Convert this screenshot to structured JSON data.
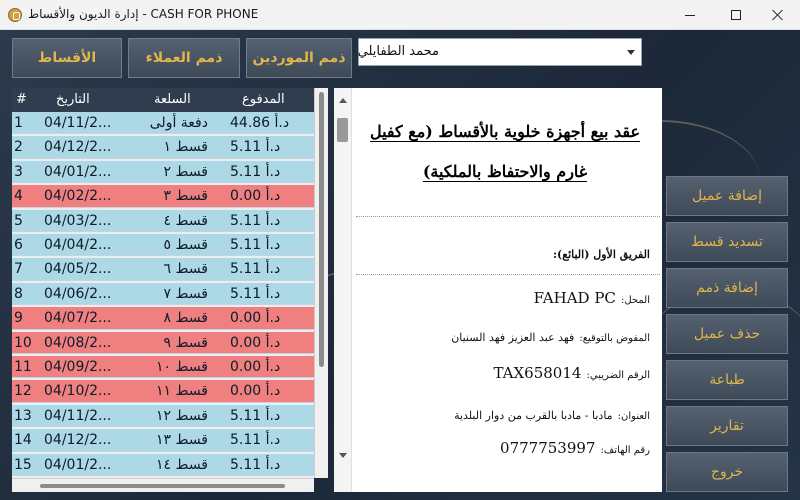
{
  "window": {
    "title": "إدارة الديون والأقساط - CASH FOR PHONE"
  },
  "nav": {
    "installments": "الأقساط",
    "customers_debts": "ذمم العملاء",
    "suppliers_debts": "ذمم الموردين"
  },
  "customer_select": {
    "value": "محمد الطفايلي"
  },
  "table": {
    "headers": {
      "num": "#",
      "date": "التاريخ",
      "item": "السلعة",
      "paid": "المدفوع"
    },
    "rows": [
      {
        "num": "1",
        "date": "04/11/2...",
        "item": "دفعة أولى",
        "paid": "د.أ 44.86",
        "status": "blue"
      },
      {
        "num": "2",
        "date": "04/12/2...",
        "item": "قسط ١",
        "paid": "د.أ 5.11",
        "status": "blue"
      },
      {
        "num": "3",
        "date": "04/01/2...",
        "item": "قسط ٢",
        "paid": "د.أ 5.11",
        "status": "blue"
      },
      {
        "num": "4",
        "date": "04/02/2...",
        "item": "قسط ٣",
        "paid": "د.أ 0.00",
        "status": "red"
      },
      {
        "num": "5",
        "date": "04/03/2...",
        "item": "قسط ٤",
        "paid": "د.أ 5.11",
        "status": "blue"
      },
      {
        "num": "6",
        "date": "04/04/2...",
        "item": "قسط ٥",
        "paid": "د.أ 5.11",
        "status": "blue"
      },
      {
        "num": "7",
        "date": "04/05/2...",
        "item": "قسط ٦",
        "paid": "د.أ 5.11",
        "status": "blue"
      },
      {
        "num": "8",
        "date": "04/06/2...",
        "item": "قسط ٧",
        "paid": "د.أ 5.11",
        "status": "blue"
      },
      {
        "num": "9",
        "date": "04/07/2...",
        "item": "قسط ٨",
        "paid": "د.أ 0.00",
        "status": "red"
      },
      {
        "num": "10",
        "date": "04/08/2...",
        "item": "قسط ٩",
        "paid": "د.أ 0.00",
        "status": "red"
      },
      {
        "num": "11",
        "date": "04/09/2...",
        "item": "قسط ١٠",
        "paid": "د.أ 0.00",
        "status": "red"
      },
      {
        "num": "12",
        "date": "04/10/2...",
        "item": "قسط ١١",
        "paid": "د.أ 0.00",
        "status": "red"
      },
      {
        "num": "13",
        "date": "04/11/2...",
        "item": "قسط ١٢",
        "paid": "د.أ 5.11",
        "status": "blue"
      },
      {
        "num": "14",
        "date": "04/12/2...",
        "item": "قسط ١٣",
        "paid": "د.أ 5.11",
        "status": "blue"
      },
      {
        "num": "15",
        "date": "04/01/2...",
        "item": "قسط ١٤",
        "paid": "د.أ 5.11",
        "status": "blue"
      }
    ]
  },
  "document": {
    "title_line1": "عقد بيع أجهزة خلوية بالأقساط (مع كفيل",
    "title_line2": "غارم والاحتفاظ بالملكية)",
    "party_first": "الفريق الأول (البائع):",
    "store_label": "المحل:",
    "store_value": "FAHAD PC",
    "signatory_label": "المفوض بالتوقيع:",
    "signatory_value": "فهد عبد العزيز فهد السنيان",
    "tax_label": "الرقم الضريبي:",
    "tax_value": "TAX658014",
    "address_label": "العنوان:",
    "address_value": "مادبا - مادبا بالقرب من دوار البلدية",
    "phone_label": "رقم الهاتف:",
    "phone_value": "0777753997"
  },
  "actions": {
    "add_customer": "إضافة عميل",
    "pay_installment": "تسديد قسط",
    "add_debt": "إضافة ذمم",
    "delete_customer": "حذف عميل",
    "print": "طباعة",
    "reports": "تقارير",
    "exit": "خروج"
  },
  "colors": {
    "paid_row": "#add8e6",
    "unpaid_row": "#f08080",
    "button_text": "#e0b64a",
    "header_bg": "#2f3d4e"
  }
}
